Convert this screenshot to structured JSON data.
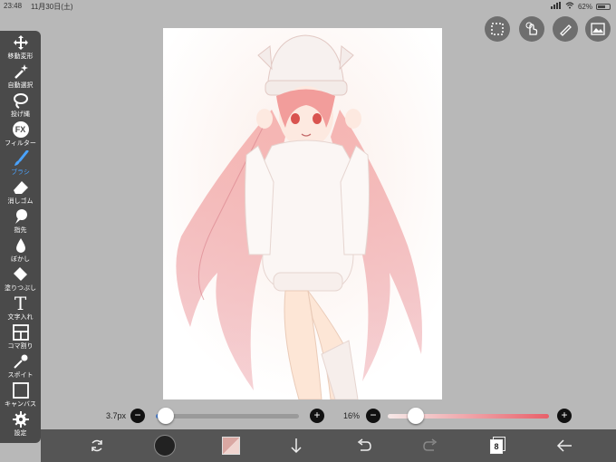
{
  "status_bar": {
    "time": "23:48",
    "date": "11月30日(土)",
    "battery": "62%"
  },
  "tools": [
    {
      "id": "move",
      "label": "移動変形",
      "icon": "move-icon"
    },
    {
      "id": "magic-wand",
      "label": "自動選択",
      "icon": "magic-wand-icon"
    },
    {
      "id": "lasso",
      "label": "投げ縄",
      "icon": "lasso-icon"
    },
    {
      "id": "filter",
      "label": "フィルター",
      "icon": "fx-icon",
      "glyph": "FX"
    },
    {
      "id": "brush",
      "label": "ブラシ",
      "icon": "brush-icon",
      "active": true
    },
    {
      "id": "eraser",
      "label": "消しゴム",
      "icon": "eraser-icon"
    },
    {
      "id": "smudge",
      "label": "指先",
      "icon": "finger-icon"
    },
    {
      "id": "blur",
      "label": "ぼかし",
      "icon": "drop-icon"
    },
    {
      "id": "fill",
      "label": "塗りつぶし",
      "icon": "bucket-icon"
    },
    {
      "id": "text",
      "label": "文字入れ",
      "icon": "text-icon",
      "glyph": "T"
    },
    {
      "id": "frame",
      "label": "コマ割り",
      "icon": "frame-divider-icon"
    },
    {
      "id": "eyedropper",
      "label": "スポイト",
      "icon": "eyedropper-icon"
    },
    {
      "id": "canvas",
      "label": "キャンバス",
      "icon": "canvas-icon"
    },
    {
      "id": "settings",
      "label": "設定",
      "icon": "gear-icon"
    }
  ],
  "brush": {
    "size_label": "3.7px",
    "size_fraction": 0.02,
    "opacity_label": "16%",
    "opacity_fraction": 0.16
  },
  "bottom_bar": {
    "layer_count": "8"
  },
  "colors": {
    "accent": "#4aa3ff",
    "toolbar_bg": "#4a4a4a",
    "bottom_bg": "#555555",
    "main_color": "#d9a7a2"
  }
}
